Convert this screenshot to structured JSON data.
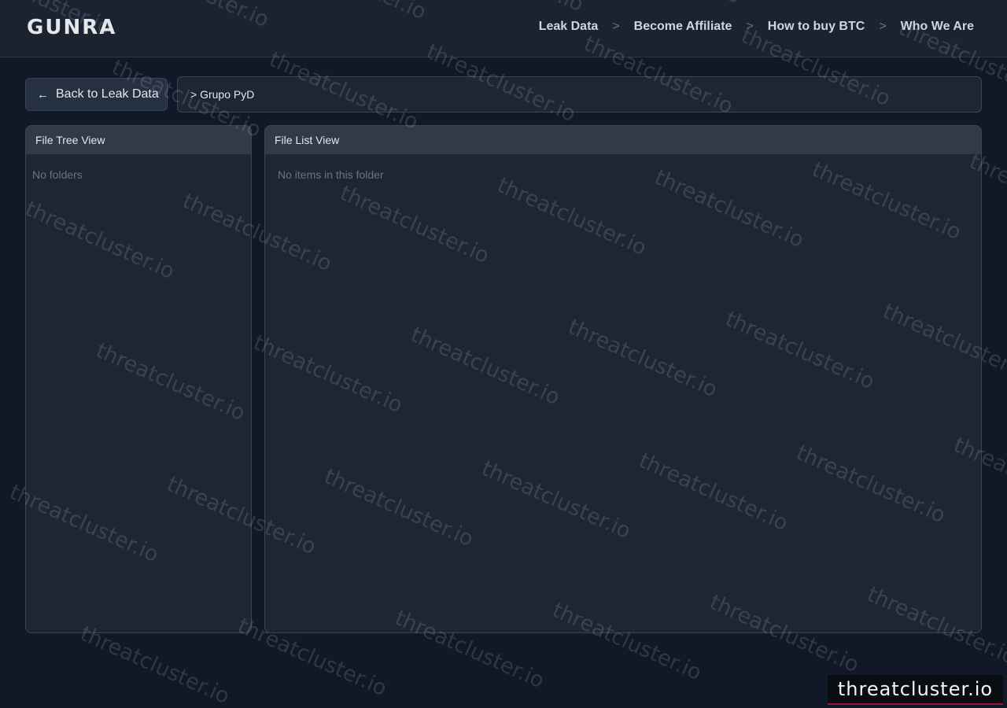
{
  "header": {
    "logo_text": "GUNRA",
    "nav": [
      {
        "label": "Leak Data"
      },
      {
        "label": "Become Affiliate"
      },
      {
        "label": "How to buy BTC"
      },
      {
        "label": "Who We Are"
      }
    ],
    "separator": ">"
  },
  "toolbar": {
    "back_label": "Back to Leak Data",
    "back_arrow": "←",
    "breadcrumb": "> Grupo PyD"
  },
  "tree_panel": {
    "title": "File Tree View",
    "empty_text": "No folders"
  },
  "list_panel": {
    "title": "File List View",
    "empty_text": "No items in this folder"
  },
  "watermark": {
    "text": "threatcluster.io"
  },
  "badge": {
    "text": "threatcluster.io"
  },
  "colors": {
    "background": "#111827",
    "header": "#1b2331",
    "panel": "#1e2633",
    "accent": "#b91c1c"
  }
}
